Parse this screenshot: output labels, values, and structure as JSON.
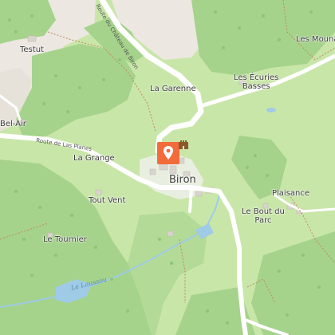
{
  "map": {
    "town": "Biron",
    "places": [
      {
        "id": "testut",
        "label": "Testut"
      },
      {
        "id": "les-mouna",
        "label": "Les Mouna"
      },
      {
        "id": "la-garenne",
        "label": "La Garenne"
      },
      {
        "id": "les-ecuries",
        "label": "Les Écuries\nBasses"
      },
      {
        "id": "bel-air",
        "label": "Bel-Air"
      },
      {
        "id": "la-grange",
        "label": "La Grange"
      },
      {
        "id": "plaisance",
        "label": "Plaisance"
      },
      {
        "id": "tout-vent",
        "label": "Tout Vent"
      },
      {
        "id": "le-bout-du-parc",
        "label": "Le Bout du\nParc"
      },
      {
        "id": "le-tournier",
        "label": "Le Tournier"
      }
    ],
    "roads": {
      "chateau": "Route du Château de Biron",
      "planes": "Route de Las Planes"
    },
    "water": {
      "stream": "Le Laussou"
    },
    "markers": {
      "pin_icon": "location-pin-icon",
      "castle_icon": "castle-icon",
      "pin_color": "#f26b3a",
      "castle_color": "#8a5a2b"
    },
    "colors": {
      "meadow": "#c9e6a9",
      "forest": "#a5d38b",
      "urban": "#ece7e1",
      "road": "#ffffff",
      "water": "#9fcbe6"
    }
  }
}
